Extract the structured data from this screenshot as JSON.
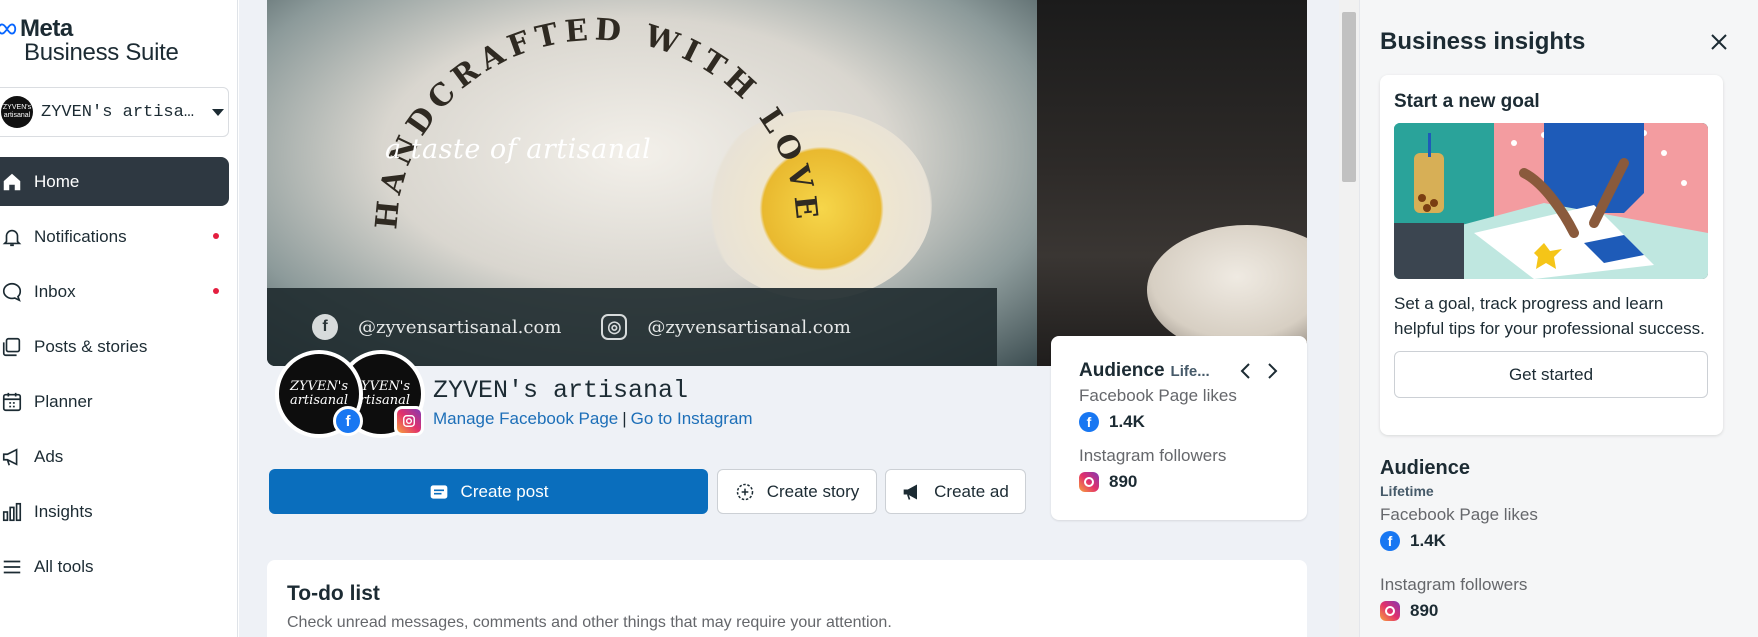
{
  "app": {
    "logo_line1": "Meta",
    "logo_line2": "Business Suite"
  },
  "account": {
    "name": "ZYVEN's artisa…",
    "avatar_text": "ZYVEN's artisanal"
  },
  "sidebar": {
    "items": [
      {
        "label": "Home",
        "icon": "home-icon",
        "active": true,
        "dot": false
      },
      {
        "label": "Notifications",
        "icon": "bell-icon",
        "active": false,
        "dot": true
      },
      {
        "label": "Inbox",
        "icon": "chat-bubble-icon",
        "active": false,
        "dot": true
      },
      {
        "label": "Posts & stories",
        "icon": "posts-icon",
        "active": false,
        "dot": false
      },
      {
        "label": "Planner",
        "icon": "calendar-icon",
        "active": false,
        "dot": false
      },
      {
        "label": "Ads",
        "icon": "megaphone-icon",
        "active": false,
        "dot": false
      },
      {
        "label": "Insights",
        "icon": "bar-chart-icon",
        "active": false,
        "dot": false
      },
      {
        "label": "All tools",
        "icon": "menu-icon",
        "active": false,
        "dot": false
      }
    ]
  },
  "cover": {
    "arch_text": "HANDCRAFTED WITH LOVE",
    "tagline": "a taste of artisanal",
    "social_fb": "@zyvensartisanal.com",
    "social_ig": "@zyvensartisanal.com"
  },
  "page": {
    "name": "ZYVEN's artisanal",
    "link_manage": "Manage Facebook Page",
    "link_separator": "|",
    "link_instagram": "Go to Instagram",
    "profile_text": "ZYVEN's artisanal"
  },
  "actions": {
    "create_post": "Create post",
    "create_story": "Create story",
    "create_ad": "Create ad"
  },
  "audience_card": {
    "title": "Audience",
    "period": "Life...",
    "fb_label": "Facebook Page likes",
    "fb_value": "1.4K",
    "ig_label": "Instagram followers",
    "ig_value": "890"
  },
  "todo": {
    "title": "To-do list",
    "subtitle": "Check unread messages, comments and other things that may require your attention."
  },
  "insights_panel": {
    "title": "Business insights",
    "goal_title": "Start a new goal",
    "goal_text": "Set a goal, track progress and learn helpful tips for your professional success.",
    "goal_button": "Get started",
    "audience_title": "Audience",
    "audience_period": "Lifetime",
    "fb_label": "Facebook Page likes",
    "fb_value": "1.4K",
    "ig_label": "Instagram followers",
    "ig_value": "890"
  },
  "colors": {
    "accent": "#0a6ebd",
    "active_nav": "#2e3841",
    "notification_dot": "#e41e3f",
    "facebook_blue": "#1877f2"
  }
}
